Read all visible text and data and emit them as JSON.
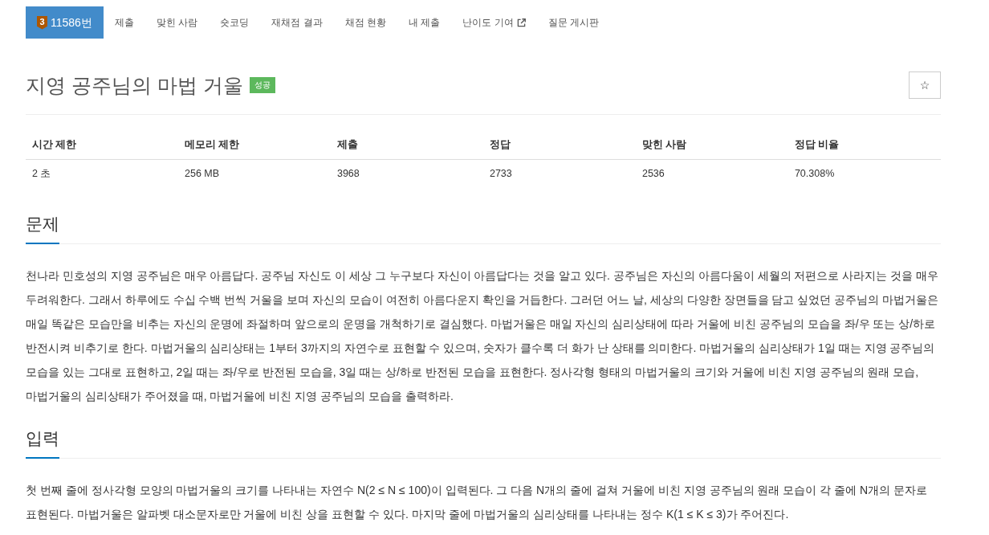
{
  "nav": {
    "items": [
      {
        "label": "11586번",
        "tier": "3",
        "selected": true,
        "external": false
      },
      {
        "label": "제출",
        "selected": false,
        "external": false
      },
      {
        "label": "맞힌 사람",
        "selected": false,
        "external": false
      },
      {
        "label": "숏코딩",
        "selected": false,
        "external": false
      },
      {
        "label": "재채점 결과",
        "selected": false,
        "external": false
      },
      {
        "label": "채점 현황",
        "selected": false,
        "external": false
      },
      {
        "label": "내 제출",
        "selected": false,
        "external": false
      },
      {
        "label": "난이도 기여",
        "selected": false,
        "external": true
      },
      {
        "label": "질문 게시판",
        "selected": false,
        "external": false
      }
    ]
  },
  "problem": {
    "title": "지영 공주님의 마법 거울",
    "status": {
      "label": "성공",
      "kind": "success"
    },
    "star_button": {
      "label": "☆"
    }
  },
  "table": {
    "columns": [
      "시간 제한",
      "메모리 제한",
      "제출",
      "정답",
      "맞힌 사람",
      "정답 비율"
    ],
    "rows": [
      [
        "2 초",
        "256 MB",
        "3968",
        "2733",
        "2536",
        "70.308%"
      ]
    ]
  },
  "sections": [
    {
      "heading": "문제",
      "text": "천나라 민호성의 지영 공주님은 매우 아름답다. 공주님 자신도 이 세상 그 누구보다 자신이 아름답다는 것을 알고 있다. 공주님은 자신의 아름다움이 세월의 저편으로 사라지는 것을 매우 두려워한다. 그래서 하루에도 수십 수백 번씩 거울을 보며 자신의 모습이 여전히 아름다운지 확인을 거듭한다. 그러던 어느 날, 세상의 다양한 장면들을 담고 싶었던 공주님의 마법거울은 매일 똑같은 모습만을 비추는 자신의 운명에 좌절하며 앞으로의 운명을 개척하기로 결심했다. 마법거울은 매일 자신의 심리상태에 따라 거울에 비친 공주님의 모습을 좌/우 또는 상/하로 반전시켜 비추기로 한다. 마법거울의 심리상태는 1부터 3까지의 자연수로 표현할 수 있으며, 숫자가 클수록 더 화가 난 상태를 의미한다. 마법거울의 심리상태가 1일 때는 지영 공주님의 모습을 있는 그대로 표현하고, 2일 때는 좌/우로 반전된 모습을, 3일 때는 상/하로 반전된 모습을 표현한다. 정사각형 형태의 마법거울의 크기와 거울에 비친 지영 공주님의 원래 모습, 마법거울의 심리상태가 주어졌을 때, 마법거울에 비친 지영 공주님의 모습을 출력하라."
    },
    {
      "heading": "입력",
      "text": "첫 번째 줄에 정사각형 모양의 마법거울의 크기를 나타내는 자연수 N(2 ≤ N ≤ 100)이 입력된다. 그 다음 N개의 줄에 걸쳐 거울에 비친 지영 공주님의 원래 모습이 각 줄에 N개의 문자로 표현된다. 마법거울은 알파벳 대소문자로만 거울에 비친 상을 표현할 수 있다. 마지막 줄에 마법거울의 심리상태를 나타내는 정수 K(1 ≤ K ≤ 3)가 주어진다."
    }
  ]
}
